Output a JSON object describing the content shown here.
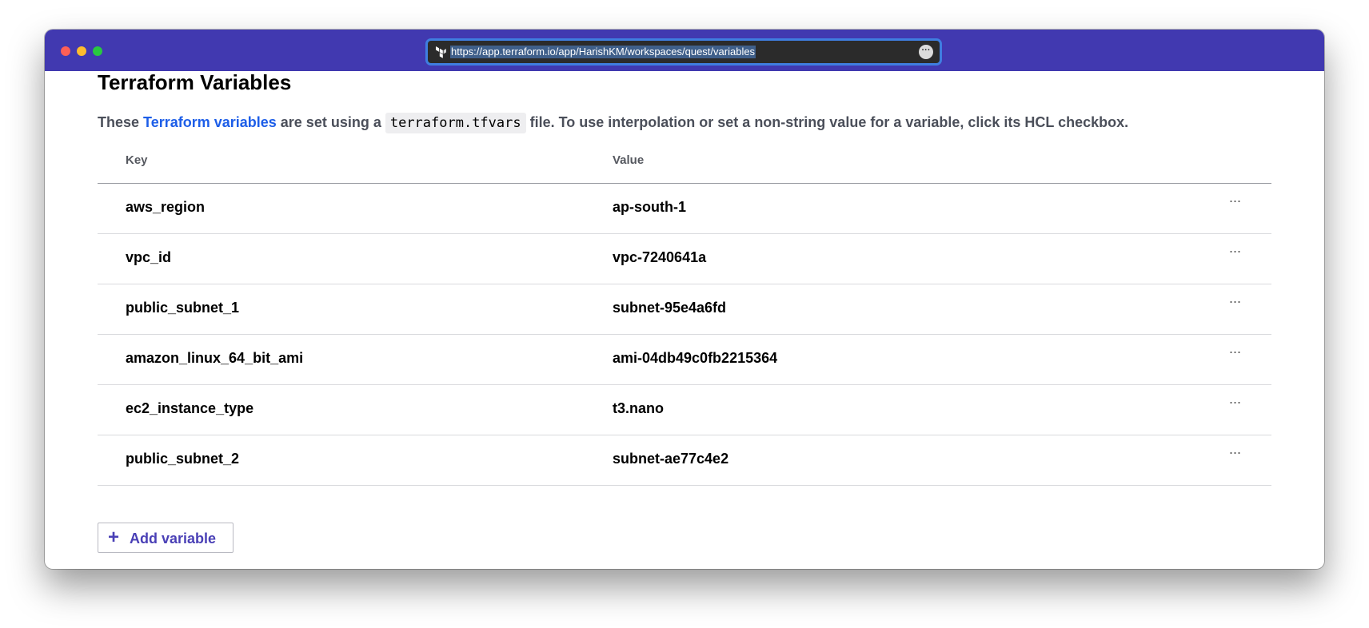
{
  "browser": {
    "url": "https://app.terraform.io/app/HarishKM/workspaces/quest/variables",
    "favicon": "terraform-logo-icon",
    "menu_icon": "ellipsis-circle-icon"
  },
  "page": {
    "title": "Terraform Variables",
    "description": {
      "part1": "These ",
      "link": "Terraform variables",
      "part2": " are set using a ",
      "code": "terraform.tfvars",
      "part3": " file. To use interpolation or set a non-string value for a variable, click its HCL checkbox."
    }
  },
  "table": {
    "headers": {
      "key": "Key",
      "value": "Value"
    },
    "rows": [
      {
        "key": "aws_region",
        "value": "ap-south-1",
        "menu": "···"
      },
      {
        "key": "vpc_id",
        "value": "vpc-7240641a",
        "menu": "···"
      },
      {
        "key": "public_subnet_1",
        "value": "subnet-95e4a6fd",
        "menu": "···"
      },
      {
        "key": "amazon_linux_64_bit_ami",
        "value": "ami-04db49c0fb2215364",
        "menu": "···"
      },
      {
        "key": "ec2_instance_type",
        "value": "t3.nano",
        "menu": "···"
      },
      {
        "key": "public_subnet_2",
        "value": "subnet-ae77c4e2",
        "menu": "···"
      }
    ]
  },
  "actions": {
    "add_variable": "Add variable",
    "add_icon": "+"
  },
  "colors": {
    "titlebar": "#4139b0",
    "link": "#1d5ee8",
    "accent": "#4a40b6"
  }
}
